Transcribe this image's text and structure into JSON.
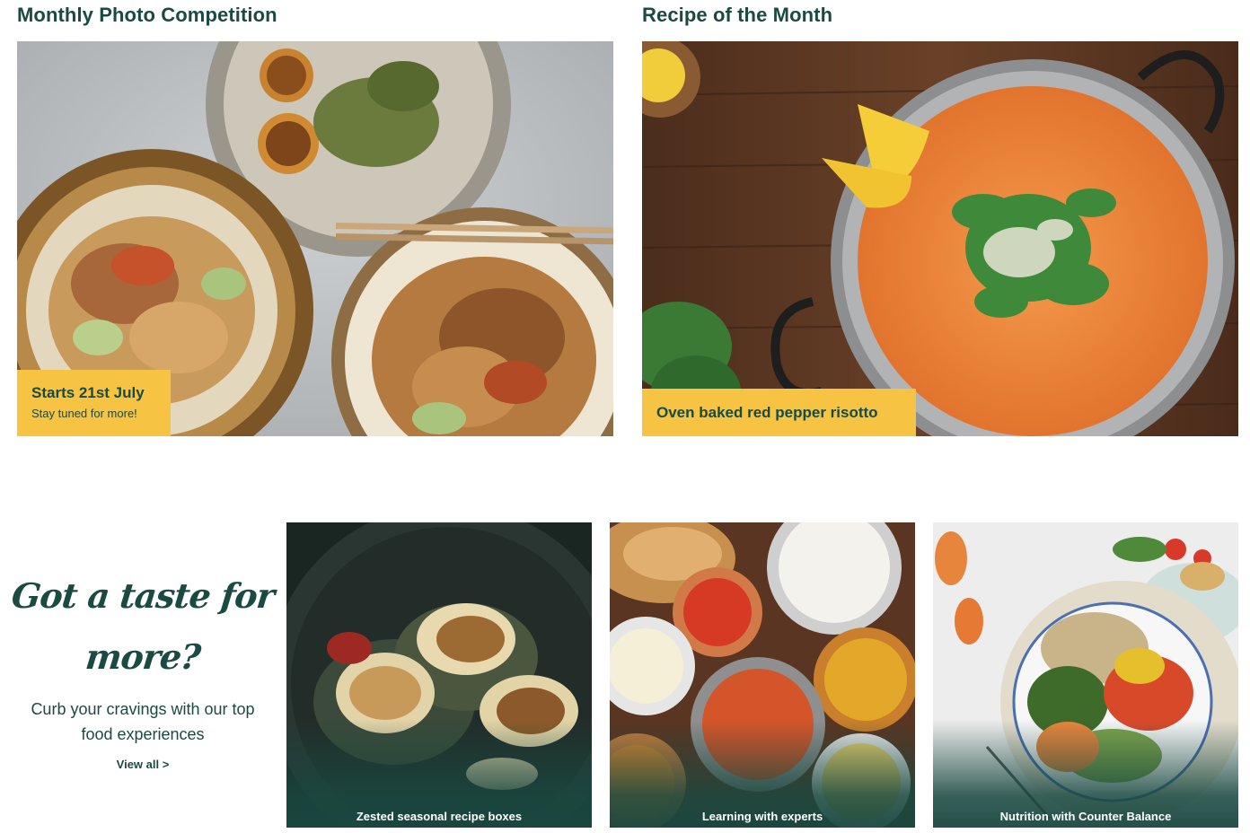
{
  "competition": {
    "heading": "Monthly Photo Competition",
    "badge_title": "Starts 21st July",
    "badge_subtitle": "Stay tuned for more!"
  },
  "recipe": {
    "heading": "Recipe of the Month",
    "badge_title": "Oven baked red pepper risotto"
  },
  "promo": {
    "heading_line1": "Got a taste for",
    "heading_line2": "more?",
    "description": "Curb your cravings with our top food experiences",
    "link_label": "View all >"
  },
  "experiences": [
    {
      "label": "Zested seasonal recipe boxes"
    },
    {
      "label": "Learning with experts"
    },
    {
      "label": "Nutrition with Counter Balance"
    }
  ],
  "colors": {
    "brand_green": "#1b4a42",
    "accent_yellow": "#f7c342",
    "background": "#ffffff"
  }
}
